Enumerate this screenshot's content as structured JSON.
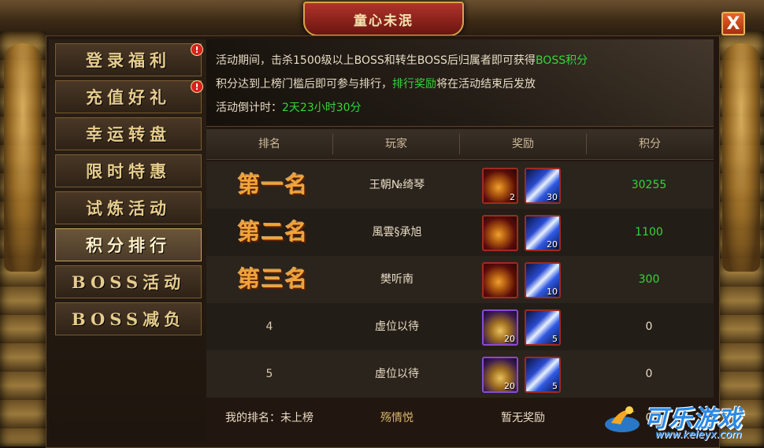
{
  "window": {
    "title": "童心未泯",
    "close_label": "X"
  },
  "sidebar": {
    "items": [
      {
        "label": "登录福利",
        "badge": "!",
        "active": false
      },
      {
        "label": "充值好礼",
        "badge": "!",
        "active": false
      },
      {
        "label": "幸运转盘",
        "badge": "",
        "active": false
      },
      {
        "label": "限时特惠",
        "badge": "",
        "active": false
      },
      {
        "label": "试炼活动",
        "badge": "",
        "active": false
      },
      {
        "label": "积分排行",
        "badge": "",
        "active": true
      },
      {
        "label": "BOSS活动",
        "badge": "",
        "active": false
      },
      {
        "label": "BOSS减负",
        "badge": "",
        "active": false
      }
    ]
  },
  "info": {
    "line1_prefix": "活动期间，击杀1500级以上BOSS和转生BOSS后归属者即可获得",
    "line1_highlight": "BOSS积分",
    "line2_prefix": "积分达到上榜门槛后即可参与排行，",
    "line2_highlight": "排行奖励",
    "line2_suffix": "将在活动结束后发放",
    "line3_prefix": "活动倒计时：",
    "line3_highlight": "2天23小时30分"
  },
  "table": {
    "headers": [
      "排名",
      "玩家",
      "奖励",
      "积分"
    ],
    "rows": [
      {
        "rank": "第一名",
        "player": "王朝№绮琴",
        "rewards": [
          {
            "icon": "potion-icon",
            "qty": "2"
          },
          {
            "icon": "crystal-icon",
            "qty": "30"
          }
        ],
        "score": "30255"
      },
      {
        "rank": "第二名",
        "player": "風雲§承旭",
        "rewards": [
          {
            "icon": "potion-icon",
            "qty": ""
          },
          {
            "icon": "crystal-icon",
            "qty": "20"
          }
        ],
        "score": "1100"
      },
      {
        "rank": "第三名",
        "player": "樊听南",
        "rewards": [
          {
            "icon": "potion-icon",
            "qty": ""
          },
          {
            "icon": "crystal-icon",
            "qty": "10"
          }
        ],
        "score": "300"
      },
      {
        "rank": "4",
        "player": "虚位以待",
        "rewards": [
          {
            "icon": "treasure-icon",
            "qty": "20"
          },
          {
            "icon": "crystal-icon",
            "qty": "5"
          }
        ],
        "score": "0"
      },
      {
        "rank": "5",
        "player": "虚位以待",
        "rewards": [
          {
            "icon": "treasure-icon",
            "qty": "20"
          },
          {
            "icon": "crystal-icon",
            "qty": "5"
          }
        ],
        "score": "0"
      }
    ]
  },
  "footer": {
    "my_rank": "我的排名：未上榜",
    "my_name": "殇情悦",
    "my_reward": "暂无奖励",
    "my_score": "0"
  },
  "watermark": {
    "text": "可乐游戏",
    "url": "www.keleyx.com"
  },
  "colors": {
    "highlight_green": "#35d63a",
    "rank_gold": "#f0a43a",
    "footer_gold": "#d9b66a"
  }
}
